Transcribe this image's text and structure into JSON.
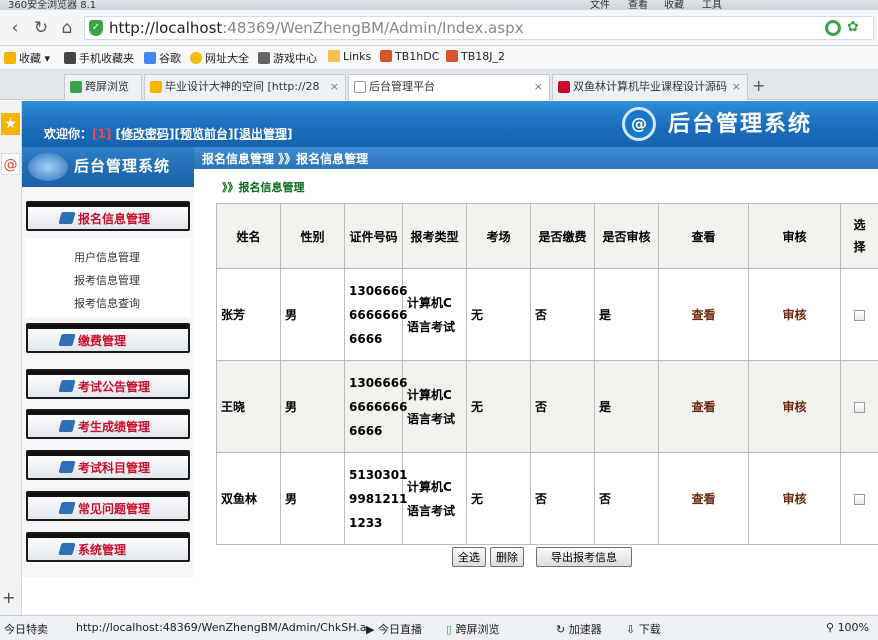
{
  "browser": {
    "window_title": "360安全浏览器 8.1",
    "title_menu": [
      "文件",
      "查看",
      "收藏",
      "工具"
    ],
    "url_host": "http://localhost",
    "url_rest": ":48369/WenZhengBM/Admin/Index.aspx",
    "favorites": [
      "收藏",
      "手机收藏夹",
      "谷歌",
      "网址大全",
      "游戏中心",
      "Links",
      "TB1hDC",
      "TB18J_2"
    ],
    "tabs": [
      {
        "label": "跨屏浏览"
      },
      {
        "label": "毕业设计大神的空间 [http://28"
      },
      {
        "label": "后台管理平台"
      },
      {
        "label": "双鱼林计算机毕业课程设计源码"
      }
    ],
    "new_tab": "+"
  },
  "header": {
    "welcome": "欢迎你：",
    "user": "[1]",
    "links": [
      "[修改密码]",
      "[预览前台]",
      "[退出管理]"
    ],
    "system_title": "后台管理系统"
  },
  "menu": {
    "title": "后台管理系统",
    "groups": [
      {
        "label": "报名信息管理"
      },
      {
        "label": "缴费管理"
      },
      {
        "label": "考试公告管理"
      },
      {
        "label": "考生成绩管理"
      },
      {
        "label": "考试科目管理"
      },
      {
        "label": "常见问题管理"
      },
      {
        "label": "系统管理"
      }
    ],
    "sub_items": [
      "用户信息管理",
      "报考信息管理",
      "报考信息查询"
    ]
  },
  "breadcrumb": "报名信息管理 》》报名信息管理",
  "page_subtitle": "》》报名信息管理",
  "table": {
    "headers": [
      "姓名",
      "性别",
      "证件号码",
      "报考类型",
      "考场",
      "是否缴费",
      "是否审核",
      "查看",
      "审核",
      "选择"
    ],
    "rows": [
      {
        "name": "张芳",
        "gender": "男",
        "id_lines": [
          "1306666",
          "6666666",
          "6666"
        ],
        "type_lines": [
          "计算机C",
          "语言考试"
        ],
        "room": "无",
        "paid": "否",
        "reviewed": "是",
        "view": "查看",
        "review": "审核"
      },
      {
        "name": "王晓",
        "gender": "男",
        "id_lines": [
          "1306666",
          "6666666",
          "6666"
        ],
        "type_lines": [
          "计算机C",
          "语言考试"
        ],
        "room": "无",
        "paid": "否",
        "reviewed": "是",
        "view": "查看",
        "review": "审核"
      },
      {
        "name": "双鱼林",
        "gender": "男",
        "id_lines": [
          "5130301",
          "9981211",
          "1233"
        ],
        "type_lines": [
          "计算机C",
          "语言考试"
        ],
        "room": "无",
        "paid": "否",
        "reviewed": "否",
        "view": "查看",
        "review": "审核"
      }
    ]
  },
  "actions": {
    "select_all": "全选",
    "delete": "删除",
    "export": "导出报考信息"
  },
  "statusbar": {
    "left": "今日特卖",
    "url": "http://localhost:48369/WenZhengBM/Admin/ChkSH.a",
    "items": [
      "今日直播",
      "跨屏浏览",
      "加速器",
      "下载"
    ],
    "zoom": "100%"
  },
  "colors": {
    "header_blue": "#1a6dbd",
    "menu_label_red": "#c8102e",
    "link_brown": "#6b2a10",
    "subtitle_green": "#0a6b1a"
  }
}
